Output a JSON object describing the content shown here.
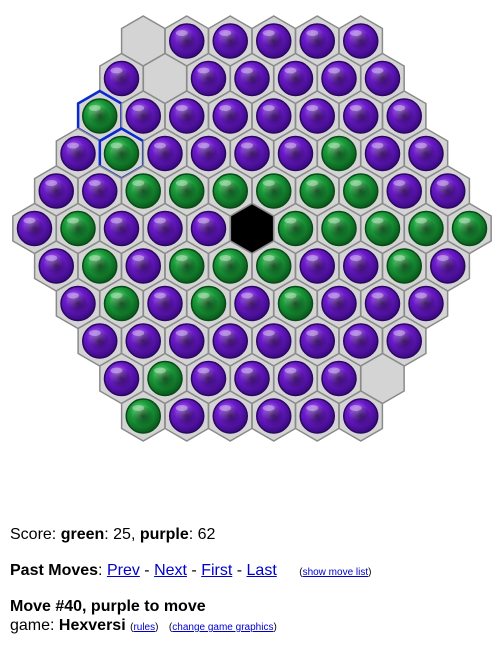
{
  "colors": {
    "green": "#1a9a3a",
    "purple": "#6a1ac8",
    "cell_fill": "#d4d4d4",
    "cell_stroke": "#8a8a8a",
    "blocked": "#000000",
    "highlight": "#0a2ad0"
  },
  "board": {
    "rows": [
      "E P P P P P",
      "P E P P P P P",
      "G P P P P P P P",
      "P G P P P P G P P",
      "P P G G G G G G P P",
      "P G P P P X G G G G G",
      "P G P G G G P P G P",
      "P G P G P G P P P",
      "P P P P P P P P",
      "P G P P P P E",
      "G P P P P P"
    ],
    "highlighted": [
      [
        2,
        0
      ],
      [
        3,
        1
      ]
    ]
  },
  "score": {
    "prefix": "Score: ",
    "green_label": "green",
    "green_value": ": 25, ",
    "purple_label": "purple",
    "purple_value": ": 62"
  },
  "past_moves": {
    "label": "Past Moves",
    "colon": ": ",
    "prev": "Prev",
    "sep1": " - ",
    "next": "Next",
    "sep2": " - ",
    "first": "First",
    "sep3": " - ",
    "last": "Last",
    "show_list_open": "(",
    "show_list": "show move list",
    "show_list_close": ")"
  },
  "status": {
    "move_line": "Move #40, purple to move",
    "game_prefix": "game: ",
    "game_name": "Hexversi",
    "rules_open": "(",
    "rules": "rules",
    "rules_close": ")",
    "graphics_open": "(",
    "graphics": "change game graphics",
    "graphics_close": ")"
  }
}
